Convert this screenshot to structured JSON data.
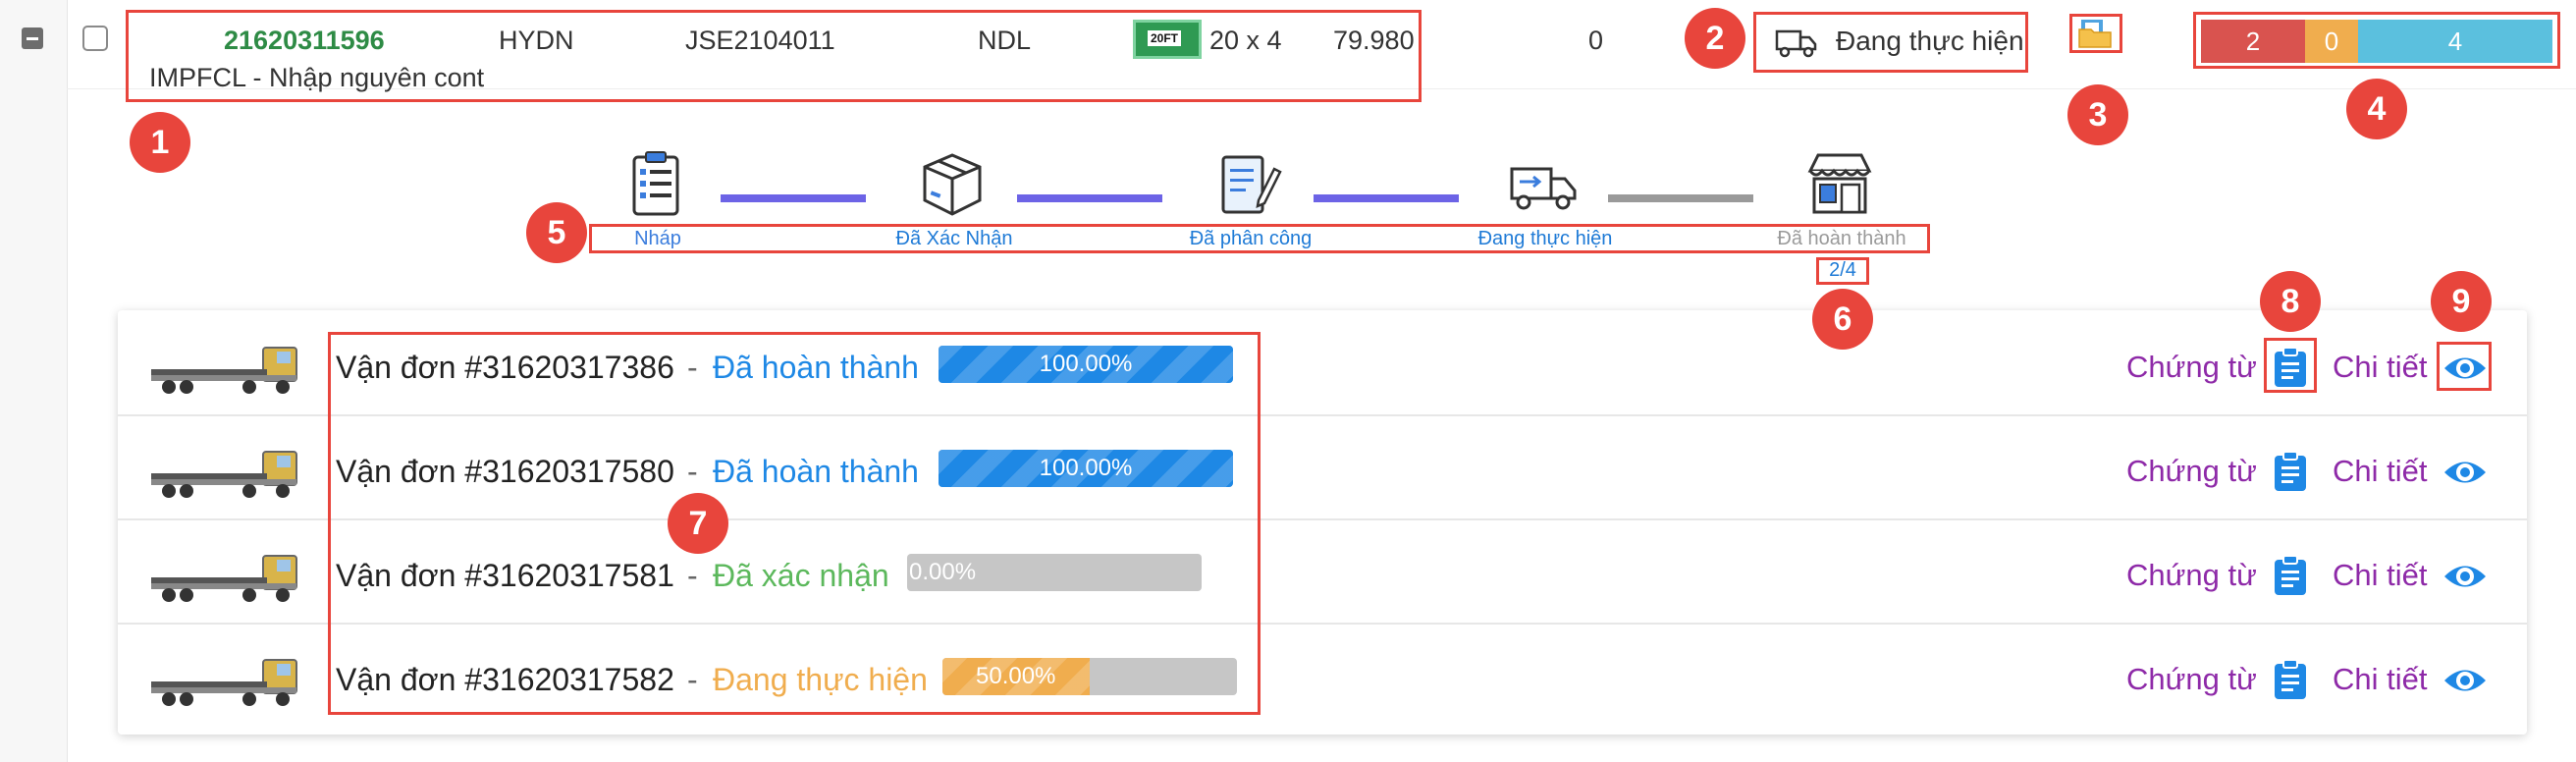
{
  "order": {
    "code": "21620311596",
    "branch": "HYDN",
    "booking": "JSE2104011",
    "carrier": "NDL",
    "container_badge": "20FT",
    "container_qty": "20 x 4",
    "amount": "79.980",
    "zero_count": "0",
    "type_label": "IMPFCL - Nhập nguyên cont"
  },
  "status_button": {
    "label": "Đang thực hiện",
    "icon": "delivery-truck-icon"
  },
  "counters": [
    {
      "value": "2",
      "color": "#d9534f"
    },
    {
      "value": "0",
      "color": "#f0ad4e"
    },
    {
      "value": "4",
      "color": "#5bc0de"
    }
  ],
  "progress_steps": [
    {
      "label": "Nháp",
      "icon": "clipboard-list-icon",
      "color": "#3b7ddd"
    },
    {
      "label": "Đã Xác Nhận",
      "icon": "package-box-icon",
      "color": "#1e7ad6"
    },
    {
      "label": "Đã phân công",
      "icon": "assign-document-icon",
      "color": "#1e7ad6"
    },
    {
      "label": "Đang thực hiện",
      "icon": "delivery-truck-icon",
      "color": "#1e7ad6"
    },
    {
      "label": "Đã hoàn thành",
      "icon": "store-icon",
      "color": "#9a9a9a"
    }
  ],
  "progress_count": "2/4",
  "shipments": [
    {
      "bill": "Vận đơn #31620317386",
      "status": "Đã hoàn thành",
      "status_color": "#1e88e5",
      "progress": 1.0,
      "progress_label": "100.00%",
      "bar_color": "#1e88e5"
    },
    {
      "bill": "Vận đơn #31620317580",
      "status": "Đã hoàn thành",
      "status_color": "#1e88e5",
      "progress": 1.0,
      "progress_label": "100.00%",
      "bar_color": "#1e88e5"
    },
    {
      "bill": "Vận đơn #31620317581",
      "status": "Đã xác nhận",
      "status_color": "#5cb85c",
      "progress": 0.0,
      "progress_label": "0.00%",
      "bar_color": "#5bc0de"
    },
    {
      "bill": "Vận đơn #31620317582",
      "status": "Đang thực hiện",
      "status_color": "#f0ad4e",
      "progress": 0.5,
      "progress_label": "50.00%",
      "bar_color": "#f0ad4e"
    }
  ],
  "separator": "-",
  "docs_label": "Chứng từ",
  "detail_label": "Chi tiết",
  "callouts": [
    "1",
    "2",
    "3",
    "4",
    "5",
    "6",
    "7",
    "8",
    "9"
  ],
  "colors": {
    "accent_red": "#e8453c",
    "order_code": "#2e8b45",
    "link_purple": "#8e2aa8",
    "icon_blue": "#1e88e5"
  }
}
